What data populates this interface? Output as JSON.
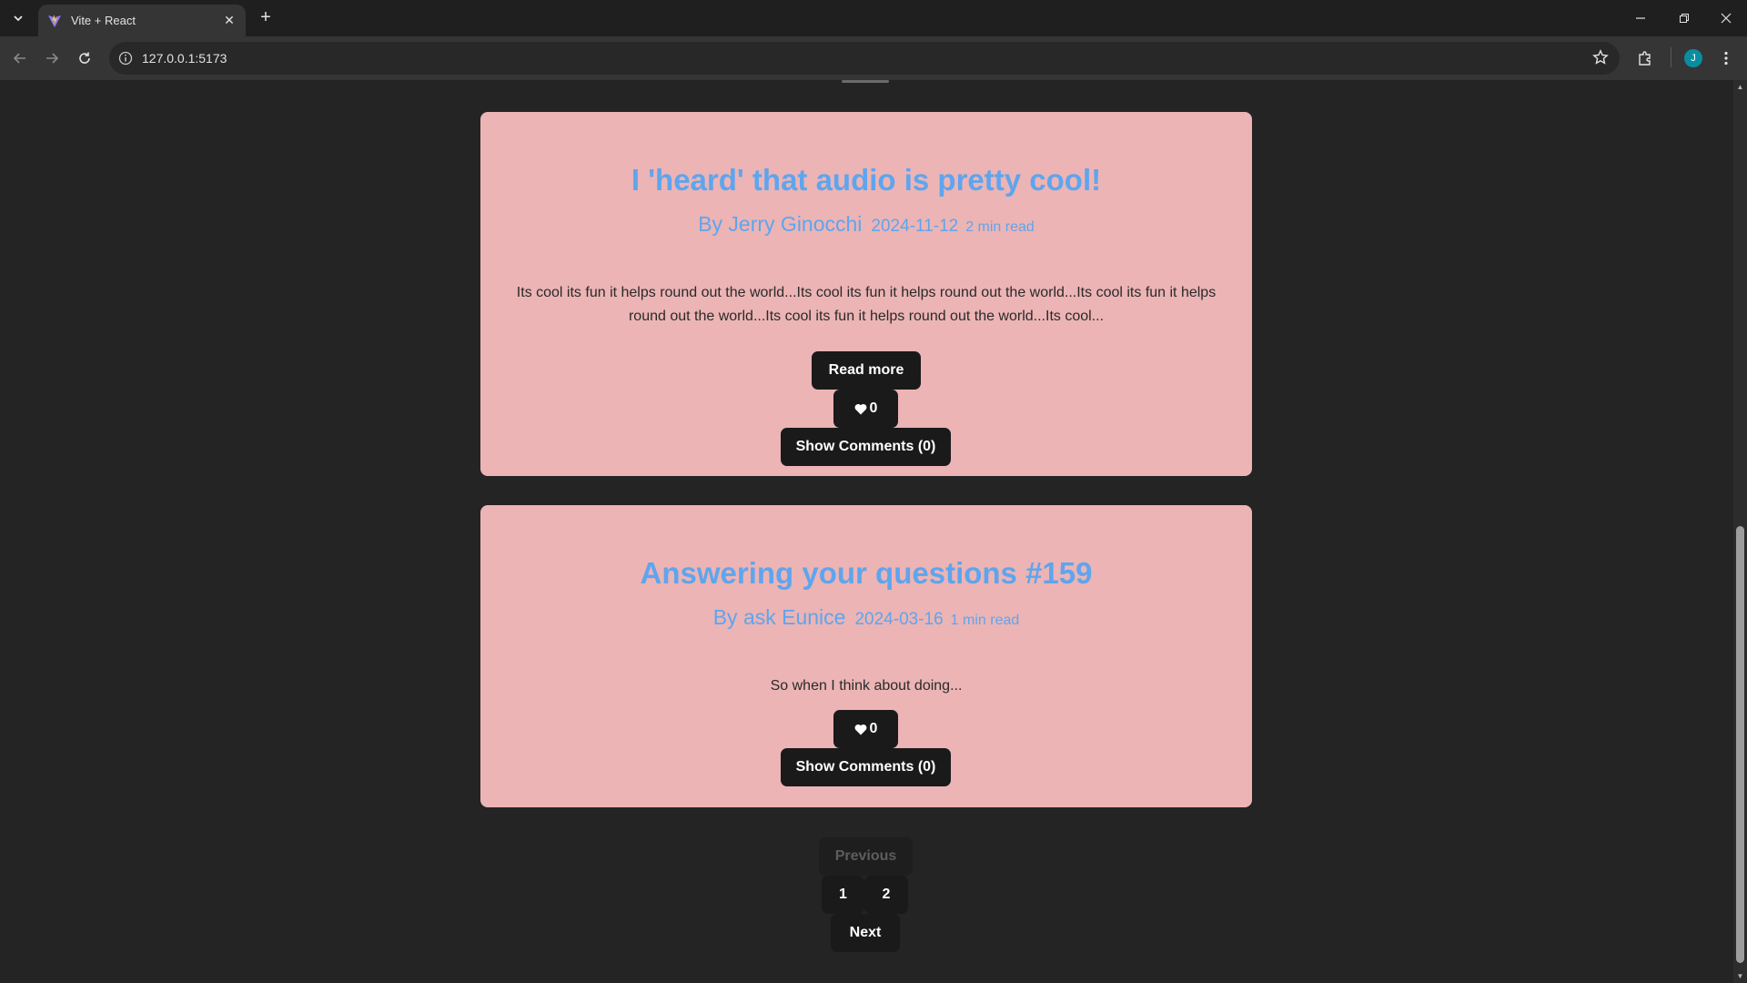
{
  "browser": {
    "tab_title": "Vite + React",
    "url": "127.0.0.1:5173",
    "avatar_letter": "J"
  },
  "posts": [
    {
      "title": "I 'heard' that audio is pretty cool!",
      "author": "By Jerry Ginocchi",
      "date": "2024-11-12",
      "read_time": "2 min read",
      "excerpt": "Its cool its fun it helps round out the world...Its cool its fun it helps round out the world...Its cool its fun it helps round out the world...Its cool its fun it helps round out the world...Its cool...",
      "read_more_label": "Read more",
      "likes": "0",
      "comments_label": "Show Comments (0)"
    },
    {
      "title": "Answering your questions #159",
      "author": "By ask Eunice",
      "date": "2024-03-16",
      "read_time": "1 min read",
      "excerpt": "So when I think about doing...",
      "likes": "0",
      "comments_label": "Show Comments (0)"
    }
  ],
  "pagination": {
    "previous_label": "Previous",
    "pages": [
      "1",
      "2"
    ],
    "next_label": "Next"
  },
  "colors": {
    "card_bg": "#ecb4b5",
    "accent_blue": "#5ea5ee",
    "page_bg": "#242424",
    "button_bg": "#1a1a1a"
  }
}
